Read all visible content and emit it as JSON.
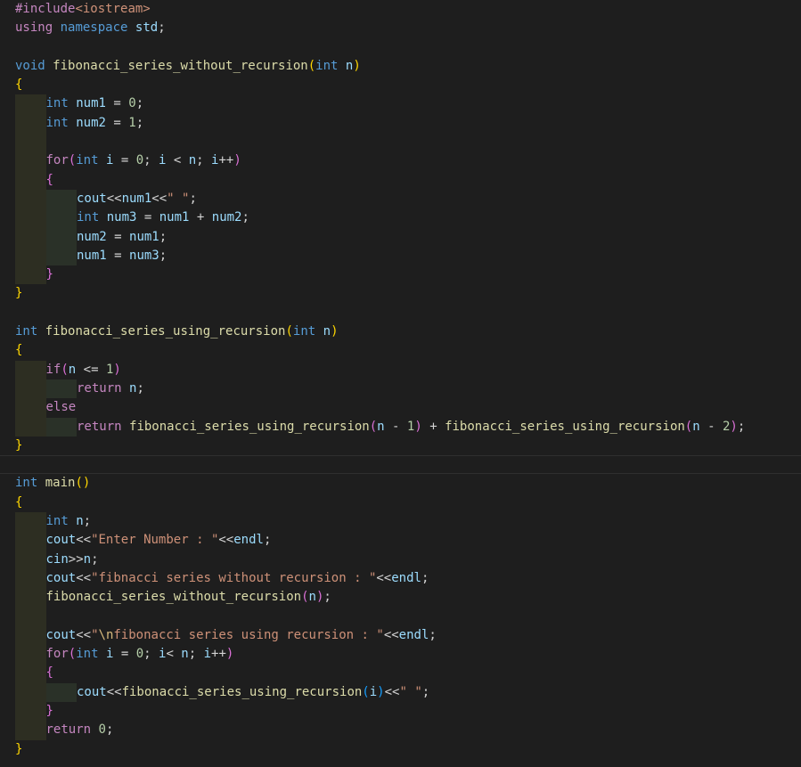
{
  "editor": {
    "theme": {
      "background": "#1e1e1e",
      "keyword": "#569cd6",
      "control": "#c586c0",
      "function": "#dcdcaa",
      "variable": "#9cdcfe",
      "number": "#b5cea8",
      "string": "#ce9178",
      "escape": "#d7ba7d",
      "plain": "#d4d4d4",
      "bracket_level_1": "#ffd700",
      "bracket_level_2": "#da70d6",
      "bracket_level_3": "#179fff"
    },
    "lines": [
      {
        "indent": 0,
        "tokens": [
          [
            "ctl",
            "#include"
          ],
          [
            "str",
            "<iostream>"
          ]
        ]
      },
      {
        "indent": 0,
        "tokens": [
          [
            "ctl",
            "using"
          ],
          [
            "plain",
            " "
          ],
          [
            "kw",
            "namespace"
          ],
          [
            "plain",
            " "
          ],
          [
            "var",
            "std"
          ],
          [
            "plain",
            ";"
          ]
        ]
      },
      {
        "indent": 0,
        "tokens": []
      },
      {
        "indent": 0,
        "tokens": [
          [
            "kw",
            "void"
          ],
          [
            "plain",
            " "
          ],
          [
            "fn",
            "fibonacci_series_without_recursion"
          ],
          [
            "b1",
            "("
          ],
          [
            "kw",
            "int"
          ],
          [
            "plain",
            " "
          ],
          [
            "var",
            "n"
          ],
          [
            "b1",
            ")"
          ]
        ]
      },
      {
        "indent": 0,
        "tokens": [
          [
            "b1",
            "{"
          ]
        ]
      },
      {
        "indent": 1,
        "tokens": [
          [
            "kw",
            "int"
          ],
          [
            "plain",
            " "
          ],
          [
            "var",
            "num1"
          ],
          [
            "plain",
            " = "
          ],
          [
            "num",
            "0"
          ],
          [
            "plain",
            ";"
          ]
        ]
      },
      {
        "indent": 1,
        "tokens": [
          [
            "kw",
            "int"
          ],
          [
            "plain",
            " "
          ],
          [
            "var",
            "num2"
          ],
          [
            "plain",
            " = "
          ],
          [
            "num",
            "1"
          ],
          [
            "plain",
            ";"
          ]
        ]
      },
      {
        "indent": 1,
        "tokens": []
      },
      {
        "indent": 1,
        "tokens": [
          [
            "ctl",
            "for"
          ],
          [
            "b2",
            "("
          ],
          [
            "kw",
            "int"
          ],
          [
            "plain",
            " "
          ],
          [
            "var",
            "i"
          ],
          [
            "plain",
            " = "
          ],
          [
            "num",
            "0"
          ],
          [
            "plain",
            "; "
          ],
          [
            "var",
            "i"
          ],
          [
            "plain",
            " < "
          ],
          [
            "var",
            "n"
          ],
          [
            "plain",
            "; "
          ],
          [
            "var",
            "i"
          ],
          [
            "plain",
            "++"
          ],
          [
            "b2",
            ")"
          ]
        ]
      },
      {
        "indent": 1,
        "tokens": [
          [
            "b2",
            "{"
          ]
        ]
      },
      {
        "indent": 2,
        "tokens": [
          [
            "var",
            "cout"
          ],
          [
            "plain",
            "<<"
          ],
          [
            "var",
            "num1"
          ],
          [
            "plain",
            "<<"
          ],
          [
            "str",
            "\" \""
          ],
          [
            "plain",
            ";"
          ]
        ]
      },
      {
        "indent": 2,
        "tokens": [
          [
            "kw",
            "int"
          ],
          [
            "plain",
            " "
          ],
          [
            "var",
            "num3"
          ],
          [
            "plain",
            " = "
          ],
          [
            "var",
            "num1"
          ],
          [
            "plain",
            " + "
          ],
          [
            "var",
            "num2"
          ],
          [
            "plain",
            ";"
          ]
        ]
      },
      {
        "indent": 2,
        "tokens": [
          [
            "var",
            "num2"
          ],
          [
            "plain",
            " = "
          ],
          [
            "var",
            "num1"
          ],
          [
            "plain",
            ";"
          ]
        ]
      },
      {
        "indent": 2,
        "tokens": [
          [
            "var",
            "num1"
          ],
          [
            "plain",
            " = "
          ],
          [
            "var",
            "num3"
          ],
          [
            "plain",
            ";"
          ]
        ]
      },
      {
        "indent": 1,
        "tokens": [
          [
            "b2",
            "}"
          ]
        ]
      },
      {
        "indent": 0,
        "tokens": [
          [
            "b1",
            "}"
          ]
        ]
      },
      {
        "indent": 0,
        "tokens": []
      },
      {
        "indent": 0,
        "tokens": [
          [
            "kw",
            "int"
          ],
          [
            "plain",
            " "
          ],
          [
            "fn",
            "fibonacci_series_using_recursion"
          ],
          [
            "b1",
            "("
          ],
          [
            "kw",
            "int"
          ],
          [
            "plain",
            " "
          ],
          [
            "var",
            "n"
          ],
          [
            "b1",
            ")"
          ]
        ]
      },
      {
        "indent": 0,
        "tokens": [
          [
            "b1",
            "{"
          ]
        ]
      },
      {
        "indent": 1,
        "tokens": [
          [
            "ctl",
            "if"
          ],
          [
            "b2",
            "("
          ],
          [
            "var",
            "n"
          ],
          [
            "plain",
            " <= "
          ],
          [
            "num",
            "1"
          ],
          [
            "b2",
            ")"
          ]
        ]
      },
      {
        "indent": 2,
        "tokens": [
          [
            "ctl",
            "return"
          ],
          [
            "plain",
            " "
          ],
          [
            "var",
            "n"
          ],
          [
            "plain",
            ";"
          ]
        ]
      },
      {
        "indent": 1,
        "tokens": [
          [
            "ctl",
            "else"
          ]
        ]
      },
      {
        "indent": 2,
        "tokens": [
          [
            "ctl",
            "return"
          ],
          [
            "plain",
            " "
          ],
          [
            "fn",
            "fibonacci_series_using_recursion"
          ],
          [
            "b2",
            "("
          ],
          [
            "var",
            "n"
          ],
          [
            "plain",
            " - "
          ],
          [
            "num",
            "1"
          ],
          [
            "b2",
            ")"
          ],
          [
            "plain",
            " + "
          ],
          [
            "fn",
            "fibonacci_series_using_recursion"
          ],
          [
            "b2",
            "("
          ],
          [
            "var",
            "n"
          ],
          [
            "plain",
            " - "
          ],
          [
            "num",
            "2"
          ],
          [
            "b2",
            ")"
          ],
          [
            "plain",
            ";"
          ]
        ]
      },
      {
        "indent": 0,
        "tokens": [
          [
            "b1",
            "}"
          ]
        ]
      },
      {
        "indent": 0,
        "current": true,
        "tokens": []
      },
      {
        "indent": 0,
        "tokens": [
          [
            "kw",
            "int"
          ],
          [
            "plain",
            " "
          ],
          [
            "fn",
            "main"
          ],
          [
            "b1",
            "()"
          ]
        ]
      },
      {
        "indent": 0,
        "tokens": [
          [
            "b1",
            "{"
          ]
        ]
      },
      {
        "indent": 1,
        "tokens": [
          [
            "kw",
            "int"
          ],
          [
            "plain",
            " "
          ],
          [
            "var",
            "n"
          ],
          [
            "plain",
            ";"
          ]
        ]
      },
      {
        "indent": 1,
        "tokens": [
          [
            "var",
            "cout"
          ],
          [
            "plain",
            "<<"
          ],
          [
            "str",
            "\"Enter Number : \""
          ],
          [
            "plain",
            "<<"
          ],
          [
            "var",
            "endl"
          ],
          [
            "plain",
            ";"
          ]
        ]
      },
      {
        "indent": 1,
        "tokens": [
          [
            "var",
            "cin"
          ],
          [
            "plain",
            ">>"
          ],
          [
            "var",
            "n"
          ],
          [
            "plain",
            ";"
          ]
        ]
      },
      {
        "indent": 1,
        "tokens": [
          [
            "var",
            "cout"
          ],
          [
            "plain",
            "<<"
          ],
          [
            "str",
            "\"fibnacci series without recursion : \""
          ],
          [
            "plain",
            "<<"
          ],
          [
            "var",
            "endl"
          ],
          [
            "plain",
            ";"
          ]
        ]
      },
      {
        "indent": 1,
        "tokens": [
          [
            "fn",
            "fibonacci_series_without_recursion"
          ],
          [
            "b2",
            "("
          ],
          [
            "var",
            "n"
          ],
          [
            "b2",
            ")"
          ],
          [
            "plain",
            ";"
          ]
        ]
      },
      {
        "indent": 1,
        "tokens": []
      },
      {
        "indent": 1,
        "tokens": [
          [
            "var",
            "cout"
          ],
          [
            "plain",
            "<<"
          ],
          [
            "str",
            "\""
          ],
          [
            "esc",
            "\\n"
          ],
          [
            "str",
            "fibonacci series using recursion : \""
          ],
          [
            "plain",
            "<<"
          ],
          [
            "var",
            "endl"
          ],
          [
            "plain",
            ";"
          ]
        ]
      },
      {
        "indent": 1,
        "tokens": [
          [
            "ctl",
            "for"
          ],
          [
            "b2",
            "("
          ],
          [
            "kw",
            "int"
          ],
          [
            "plain",
            " "
          ],
          [
            "var",
            "i"
          ],
          [
            "plain",
            " = "
          ],
          [
            "num",
            "0"
          ],
          [
            "plain",
            "; "
          ],
          [
            "var",
            "i"
          ],
          [
            "plain",
            "< "
          ],
          [
            "var",
            "n"
          ],
          [
            "plain",
            "; "
          ],
          [
            "var",
            "i"
          ],
          [
            "plain",
            "++"
          ],
          [
            "b2",
            ")"
          ]
        ]
      },
      {
        "indent": 1,
        "tokens": [
          [
            "b2",
            "{"
          ]
        ]
      },
      {
        "indent": 2,
        "tokens": [
          [
            "var",
            "cout"
          ],
          [
            "plain",
            "<<"
          ],
          [
            "fn",
            "fibonacci_series_using_recursion"
          ],
          [
            "b3",
            "("
          ],
          [
            "var",
            "i"
          ],
          [
            "b3",
            ")"
          ],
          [
            "plain",
            "<<"
          ],
          [
            "str",
            "\" \""
          ],
          [
            "plain",
            ";"
          ]
        ]
      },
      {
        "indent": 1,
        "tokens": [
          [
            "b2",
            "}"
          ]
        ]
      },
      {
        "indent": 1,
        "tokens": [
          [
            "ctl",
            "return"
          ],
          [
            "plain",
            " "
          ],
          [
            "num",
            "0"
          ],
          [
            "plain",
            ";"
          ]
        ]
      },
      {
        "indent": 0,
        "tokens": [
          [
            "b1",
            "}"
          ]
        ]
      }
    ]
  }
}
